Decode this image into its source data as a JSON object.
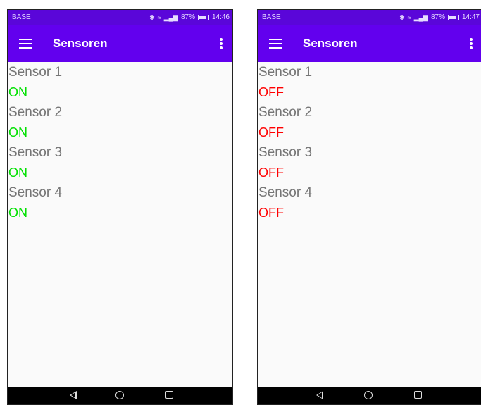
{
  "screens": [
    {
      "status": {
        "carrier": "BASE",
        "signal_text": "87%",
        "time": "14:46"
      },
      "toolbar": {
        "title": "Sensoren"
      },
      "sensors": [
        {
          "label": "Sensor 1",
          "state": "ON"
        },
        {
          "label": "Sensor 2",
          "state": "ON"
        },
        {
          "label": "Sensor 3",
          "state": "ON"
        },
        {
          "label": "Sensor 4",
          "state": "ON"
        }
      ]
    },
    {
      "status": {
        "carrier": "BASE",
        "signal_text": "87%",
        "time": "14:47"
      },
      "toolbar": {
        "title": "Sensoren"
      },
      "sensors": [
        {
          "label": "Sensor 1",
          "state": "OFF"
        },
        {
          "label": "Sensor 2",
          "state": "OFF"
        },
        {
          "label": "Sensor 3",
          "state": "OFF"
        },
        {
          "label": "Sensor 4",
          "state": "OFF"
        }
      ]
    }
  ],
  "colors": {
    "toolbar": "#6200ee",
    "statusbar": "#5a06d9",
    "on": "#00e000",
    "off": "#ff0000",
    "label": "#757575"
  },
  "icons": {
    "menu": "menu-icon",
    "overflow": "overflow-menu-icon",
    "back": "back-icon",
    "home": "home-icon",
    "recents": "recents-icon"
  }
}
